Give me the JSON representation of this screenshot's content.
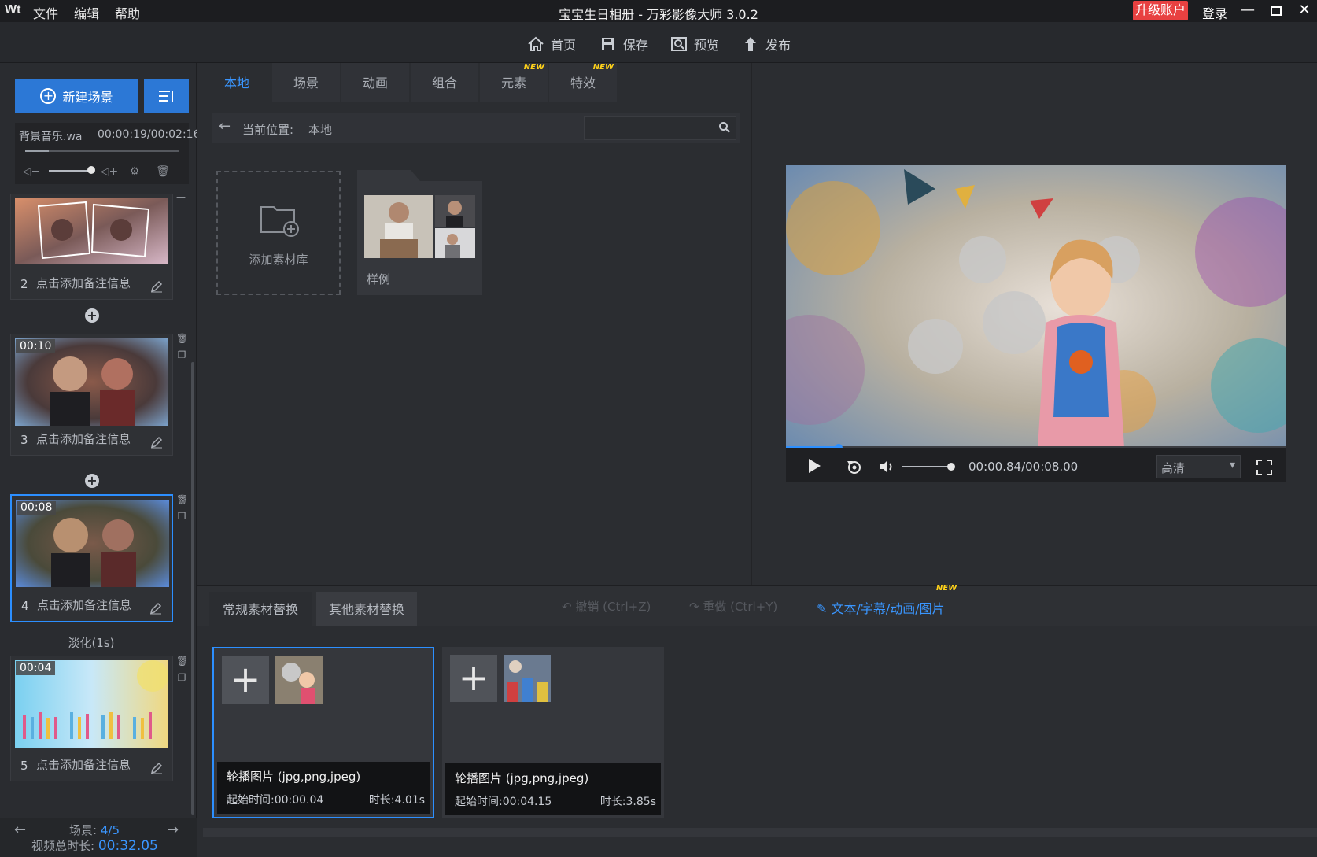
{
  "menubar": {
    "logo": "Wt",
    "items": [
      "文件",
      "编辑",
      "帮助"
    ],
    "title": "宝宝生日相册 - 万彩影像大师 3.0.2",
    "upgrade": "升级账户",
    "login": "登录"
  },
  "toolbar": {
    "home": "首页",
    "save": "保存",
    "preview": "预览",
    "publish": "发布"
  },
  "left": {
    "new_scene": "新建场景",
    "music_name": "背景音乐.wa",
    "music_time": "00:00:19/00:02:16",
    "scenes": [
      {
        "num": "2",
        "note": "点击添加备注信息",
        "duration": ""
      },
      {
        "num": "3",
        "note": "点击添加备注信息",
        "duration": "00:10"
      },
      {
        "num": "4",
        "note": "点击添加备注信息",
        "duration": "00:08"
      },
      {
        "num": "5",
        "note": "点击添加备注信息",
        "duration": "00:04"
      }
    ],
    "transition": "淡化(1s)",
    "scene_label": "场景:",
    "scene_index": "4/5",
    "total_label": "视频总时长:",
    "total_value": "00:32.05"
  },
  "tabs": [
    {
      "label": "本地",
      "new": ""
    },
    {
      "label": "场景",
      "new": ""
    },
    {
      "label": "动画",
      "new": ""
    },
    {
      "label": "组合",
      "new": ""
    },
    {
      "label": "元素",
      "new": "NEW"
    },
    {
      "label": "特效",
      "new": "NEW"
    }
  ],
  "pathbar": {
    "label": "当前位置:",
    "value": "本地",
    "search_placeholder": ""
  },
  "library": {
    "add_label": "添加素材库",
    "sample_label": "样例"
  },
  "player": {
    "timecode": "00:00.84/00:08.00",
    "quality": "高清",
    "progress_fraction": 0.105
  },
  "bottom": {
    "tab_regular": "常规素材替换",
    "tab_other": "其他素材替换",
    "undo": "撤销 (Ctrl+Z)",
    "redo": "重做 (Ctrl+Y)",
    "text_link": "文本/字幕/动画/图片",
    "new_badge": "NEW",
    "cards": [
      {
        "title": "轮播图片 (jpg,png,jpeg)",
        "start": "起始时间:00:00.04",
        "length": "时长:4.01s"
      },
      {
        "title": "轮播图片 (jpg,png,jpeg)",
        "start": "起始时间:00:04.15",
        "length": "时长:3.85s"
      }
    ]
  },
  "colors": {
    "accent": "#2c78d6",
    "link": "#3a96ff",
    "upgrade": "#e84141",
    "new_badge": "#ffd21a"
  }
}
